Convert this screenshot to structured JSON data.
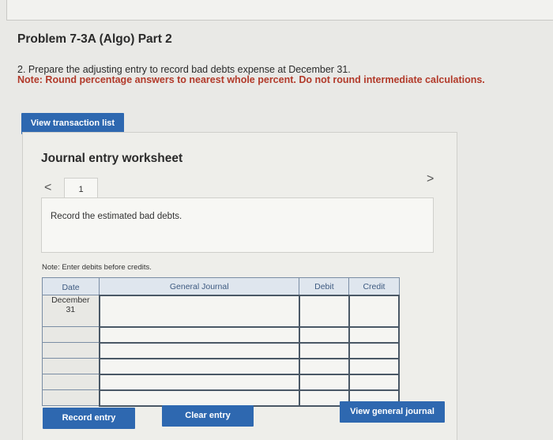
{
  "problem": {
    "title": "Problem 7-3A (Algo) Part 2",
    "instruction": "2. Prepare the adjusting entry to record bad debts expense at December 31.",
    "note": "Note: Round percentage answers to nearest whole percent. Do not round intermediate calculations."
  },
  "buttons": {
    "view_transaction_list": "View transaction list",
    "record_entry": "Record entry",
    "clear_entry": "Clear entry",
    "view_general_journal": "View general journal"
  },
  "worksheet": {
    "title": "Journal entry worksheet",
    "tab_number": "1",
    "record_text": "Record the estimated bad debts.",
    "enter_note": "Note: Enter debits before credits."
  },
  "journal": {
    "headers": {
      "date": "Date",
      "general_journal": "General Journal",
      "debit": "Debit",
      "credit": "Credit"
    },
    "rows": [
      {
        "date": "December\n31"
      },
      {
        "date": ""
      },
      {
        "date": ""
      },
      {
        "date": ""
      },
      {
        "date": ""
      },
      {
        "date": ""
      }
    ]
  },
  "colors": {
    "button_blue": "#2e68b0",
    "note_red": "#b23a2a",
    "header_bg": "#dfe6ee"
  },
  "icons": {
    "prev": "chevron-left-icon",
    "next": "chevron-right-icon"
  }
}
